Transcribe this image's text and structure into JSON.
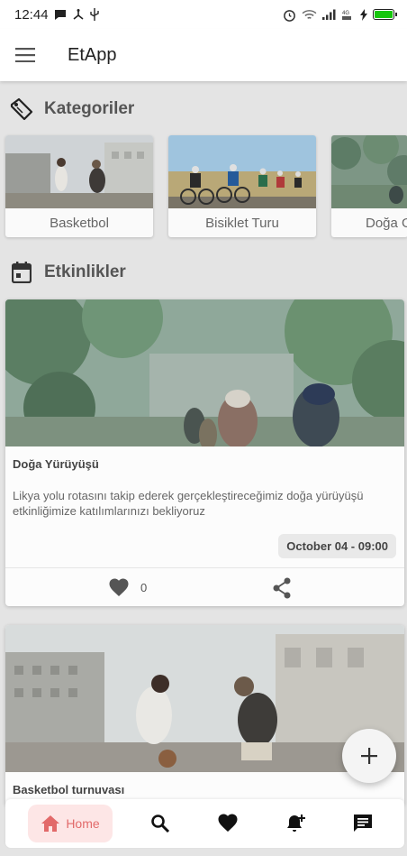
{
  "status_bar": {
    "time": "12:44"
  },
  "app": {
    "title": "EtApp"
  },
  "categories_section": {
    "title": "Kategoriler",
    "items": [
      {
        "label": "Basketbol"
      },
      {
        "label": "Bisiklet Turu"
      },
      {
        "label": "Doğa Gezisi"
      }
    ]
  },
  "events_section": {
    "title": "Etkinlikler",
    "events": [
      {
        "title": "Doğa Yürüyüşü",
        "description": "Likya yolu rotasını takip ederek gerçekleştireceğimiz doğa yürüyüşü etkinliğimize katılımlarınızı bekliyoruz",
        "date": "October 04 - 09:00",
        "likes": "0"
      },
      {
        "title": "Basketbol turnuvası"
      }
    ]
  },
  "bottom_nav": {
    "home_label": "Home"
  },
  "colors": {
    "accent": "#e26a6a",
    "accent_bg": "#fde6e6",
    "battery": "#16c60c"
  }
}
